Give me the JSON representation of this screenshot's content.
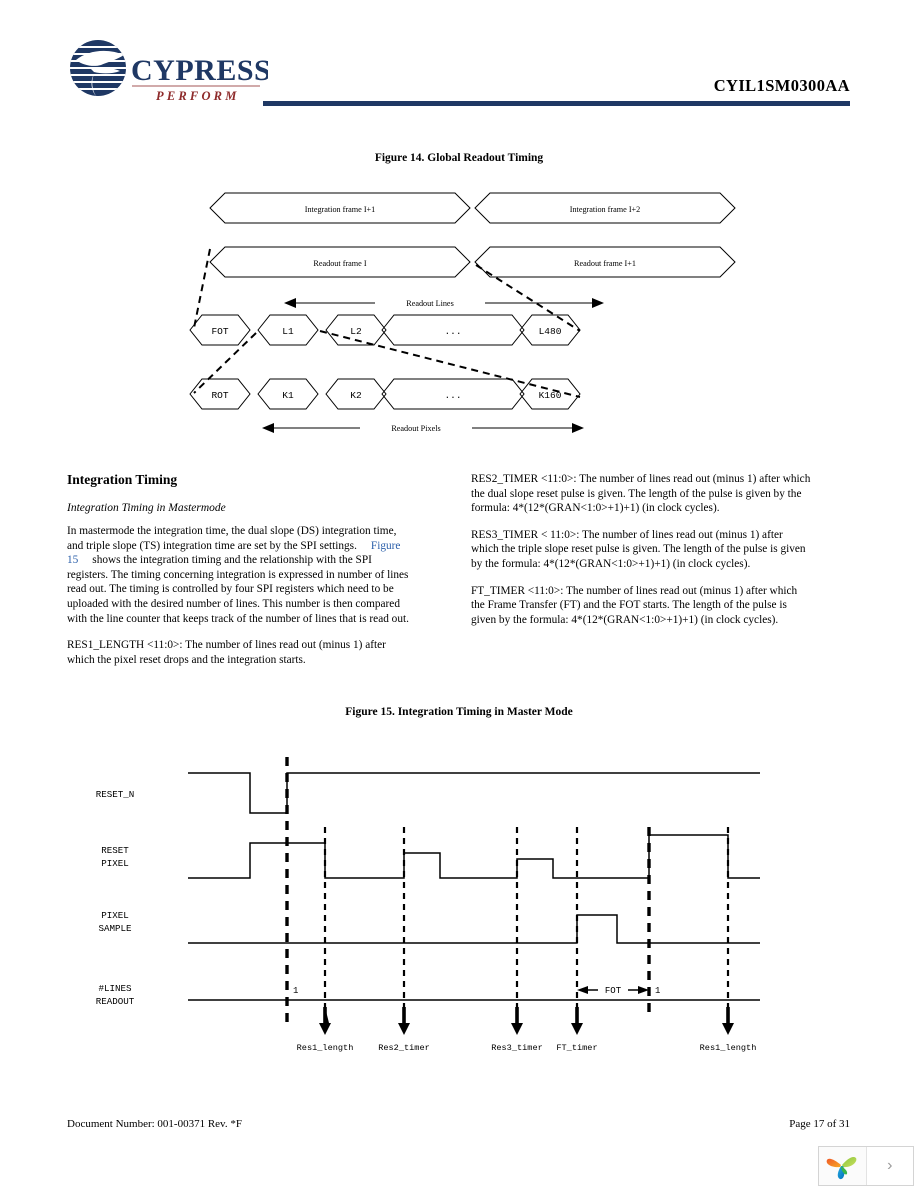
{
  "header": {
    "part_number": "CYIL1SM0300AA",
    "logo_text": "CYPRESS",
    "logo_tagline": "PERFORM",
    "rule_color": "#1F3864"
  },
  "figure14": {
    "caption": "Figure 14.  Global Readout Timing",
    "integration_frames": [
      "Integration frame I+1",
      "Integration frame I+2"
    ],
    "readout_frames": [
      "Readout frame I",
      "Readout frame I+1"
    ],
    "lines_label": "Readout Lines",
    "pixels_label": "Readout Pixels",
    "line_cells": [
      "FOT",
      "L1",
      "L2",
      "...",
      "L480"
    ],
    "pixel_cells": [
      "ROT",
      "K1",
      "K2",
      "...",
      "K160"
    ]
  },
  "content": {
    "section_title": "Integration Timing",
    "subsection_title": "Integration Timing in Mastermode",
    "para1_a": "In mastermode the integration time, the dual slope (DS) integration time, and triple slope (TS) integration time are set by the SPI settings.",
    "para1_link": "Figure 15",
    "para1_b": "shows the integration timing and the relationship with the SPI registers. The timing concerning integration is expressed in number of lines read out. The timing is controlled by four SPI registers which need to be uploaded with the desired number of lines. This number is then compared with the line counter that keeps track of the number of lines that is read out.",
    "para_res1": "RES1_LENGTH <11:0>: The number of lines read out (minus 1) after which the pixel reset drops and the integration starts.",
    "para_res2": "RES2_TIMER <11:0>: The number of lines read out (minus 1) after which the dual slope reset pulse is given. The length of the pulse is given by the formula: 4*(12*(GRAN<1:0>+1)+1) (in clock cycles).",
    "para_res3": "RES3_TIMER < 11:0>: The number of lines read out (minus 1) after which the triple slope reset pulse is given. The length of the pulse is given by the formula: 4*(12*(GRAN<1:0>+1)+1) (in clock cycles).",
    "para_ft": "FT_TIMER <11:0>: The number of lines read out (minus 1) after which the Frame Transfer (FT) and the FOT starts. The length of the pulse is given by the formula: 4*(12*(GRAN<1:0>+1)+1) (in clock cycles)."
  },
  "figure15": {
    "caption": "Figure 15.  Integration Timing in Master Mode",
    "signals": [
      {
        "name": "RESET_N",
        "line2": ""
      },
      {
        "name": "RESET",
        "line2": "PIXEL"
      },
      {
        "name": "PIXEL",
        "line2": "SAMPLE"
      },
      {
        "name": "#LINES",
        "line2": "READOUT"
      }
    ],
    "marker_one_left": "1",
    "marker_one_right": "1",
    "fot_label": "FOT",
    "bottom_labels": [
      "Res1_length",
      "Res2_timer",
      "Res3_timer",
      "FT_timer",
      "Res1_length"
    ]
  },
  "footer": {
    "document_number": "Document Number: 001-00371  Rev. *F",
    "page": "Page 17 of 31"
  },
  "viewer": {
    "next_glyph": "›"
  }
}
